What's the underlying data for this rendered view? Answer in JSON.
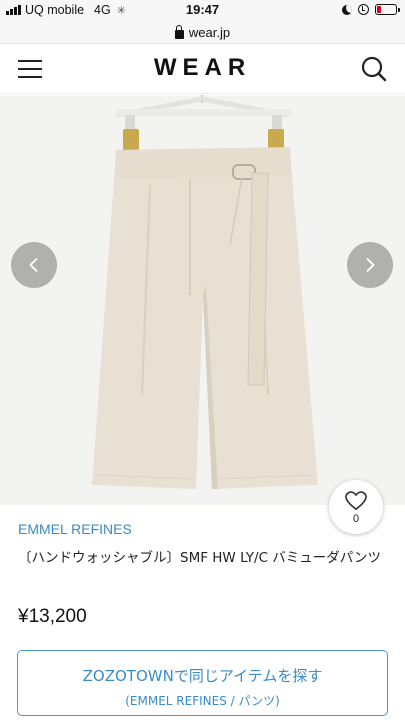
{
  "status_bar": {
    "carrier": "UQ mobile",
    "network": "4G",
    "time": "19:47",
    "battery_level": 0.2,
    "icons": [
      "signal-icon",
      "loading-icon",
      "moon-icon",
      "alarm-icon",
      "battery-icon"
    ]
  },
  "browser": {
    "domain": "wear.jp",
    "icons": [
      "lock-icon"
    ]
  },
  "header": {
    "logo": "WEAR",
    "icons": [
      "menu-icon",
      "search-icon"
    ]
  },
  "gallery": {
    "icons": [
      "chevron-left-icon",
      "chevron-right-icon"
    ]
  },
  "product": {
    "brand": "EMMEL REFINES",
    "name": "〔ハンドウォッシャブル〕SMF HW LY/C バミューダパンツ",
    "price": "¥13,200",
    "like_count": "0"
  },
  "zozotown_button": {
    "main": "ZOZOTOWNで同じアイテムを探す",
    "sub": "(EMMEL REFINES / パンツ)"
  },
  "colors": {
    "accent_blue": "#3a8bc7",
    "battery_red": "#d0021b",
    "product_beige": "#e8e0d2"
  }
}
